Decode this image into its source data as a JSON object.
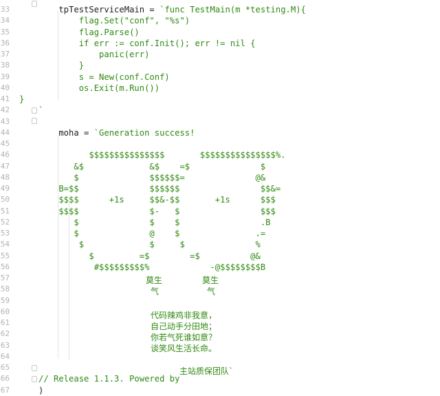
{
  "editor": {
    "colors": {
      "default_text": "#1d1d1d",
      "string_text": "#2f8a12",
      "line_number": "#b2b2b2",
      "background": "#ffffff",
      "indent_guide": "#e4e4e4"
    },
    "lines": [
      {
        "num": "33",
        "k": "    tpTestServiceMain = ",
        "s": "`func TestMain(m *testing.M){"
      },
      {
        "num": "34",
        "k": "",
        "s": "        flag.Set(\"conf\", \"%s\")"
      },
      {
        "num": "35",
        "k": "",
        "s": "        flag.Parse()"
      },
      {
        "num": "36",
        "k": "",
        "s": "        if err := conf.Init(); err != nil {"
      },
      {
        "num": "37",
        "k": "",
        "s": "            panic(err)"
      },
      {
        "num": "38",
        "k": "",
        "s": "        }"
      },
      {
        "num": "39",
        "k": "",
        "s": "        s = New(conf.Conf)"
      },
      {
        "num": "40",
        "k": "",
        "s": "        os.Exit(m.Run())"
      },
      {
        "num": "41",
        "k": "",
        "s": "}"
      },
      {
        "num": "42",
        "k": "",
        "s": "`"
      },
      {
        "num": "43",
        "k": "",
        "s": ""
      },
      {
        "num": "44",
        "k": "    moha = ",
        "s": "`Generation success!"
      },
      {
        "num": "45",
        "k": "",
        "s": ""
      },
      {
        "num": "46",
        "k": "",
        "s": "          $$$$$$$$$$$$$$$       $$$$$$$$$$$$$$$%."
      },
      {
        "num": "47",
        "k": "",
        "s": "       &$             &$    =$              $"
      },
      {
        "num": "48",
        "k": "",
        "s": "       $              $$$$$$=              @&"
      },
      {
        "num": "49",
        "k": "",
        "s": "    B=$$              $$$$$$                $$&="
      },
      {
        "num": "50",
        "k": "",
        "s": "    $$$$      +1s     $$&-$$       +1s      $$$"
      },
      {
        "num": "51",
        "k": "",
        "s": "    $$$$              $-   $                $$$"
      },
      {
        "num": "52",
        "k": "",
        "s": "       $              $    $                .B"
      },
      {
        "num": "53",
        "k": "",
        "s": "       $              @    $               .="
      },
      {
        "num": "54",
        "k": "",
        "s": "        $             $     $              %"
      },
      {
        "num": "55",
        "k": "",
        "s": "          $         =$        =$          @&"
      },
      {
        "num": "56",
        "k": "",
        "s": "           #$$$$$$$$$%            -@$$$$$$$$B"
      },
      {
        "num": "57",
        "k": "",
        "s": ""
      },
      {
        "num": "58",
        "k": "",
        "s": ""
      },
      {
        "num": "59",
        "k": "",
        "s": ""
      },
      {
        "num": "60",
        "k": "",
        "s": ""
      },
      {
        "num": "61",
        "k": "",
        "s": ""
      },
      {
        "num": "62",
        "k": "",
        "s": ""
      },
      {
        "num": "63",
        "k": "",
        "s": ""
      },
      {
        "num": "64",
        "k": "",
        "s": ""
      },
      {
        "num": "65",
        "k": "",
        "s": ""
      },
      {
        "num": "66",
        "k": "",
        "s": "// Release 1.1.3. Powered by "
      },
      {
        "num": "67",
        "k": "",
        "s": ")"
      }
    ],
    "cjk_blocks": {
      "mosheng_left_1": "莫生",
      "mosheng_left_2": "气",
      "mosheng_right_1": "莫生",
      "mosheng_right_2": "气",
      "poem_1": "代码辣鸡非我意，",
      "poem_2": "自己动手分田地；",
      "poem_3": "你若气死谁如意？",
      "poem_4": "谈笑风生活长命。",
      "team_name": "主站质保团队`"
    }
  }
}
